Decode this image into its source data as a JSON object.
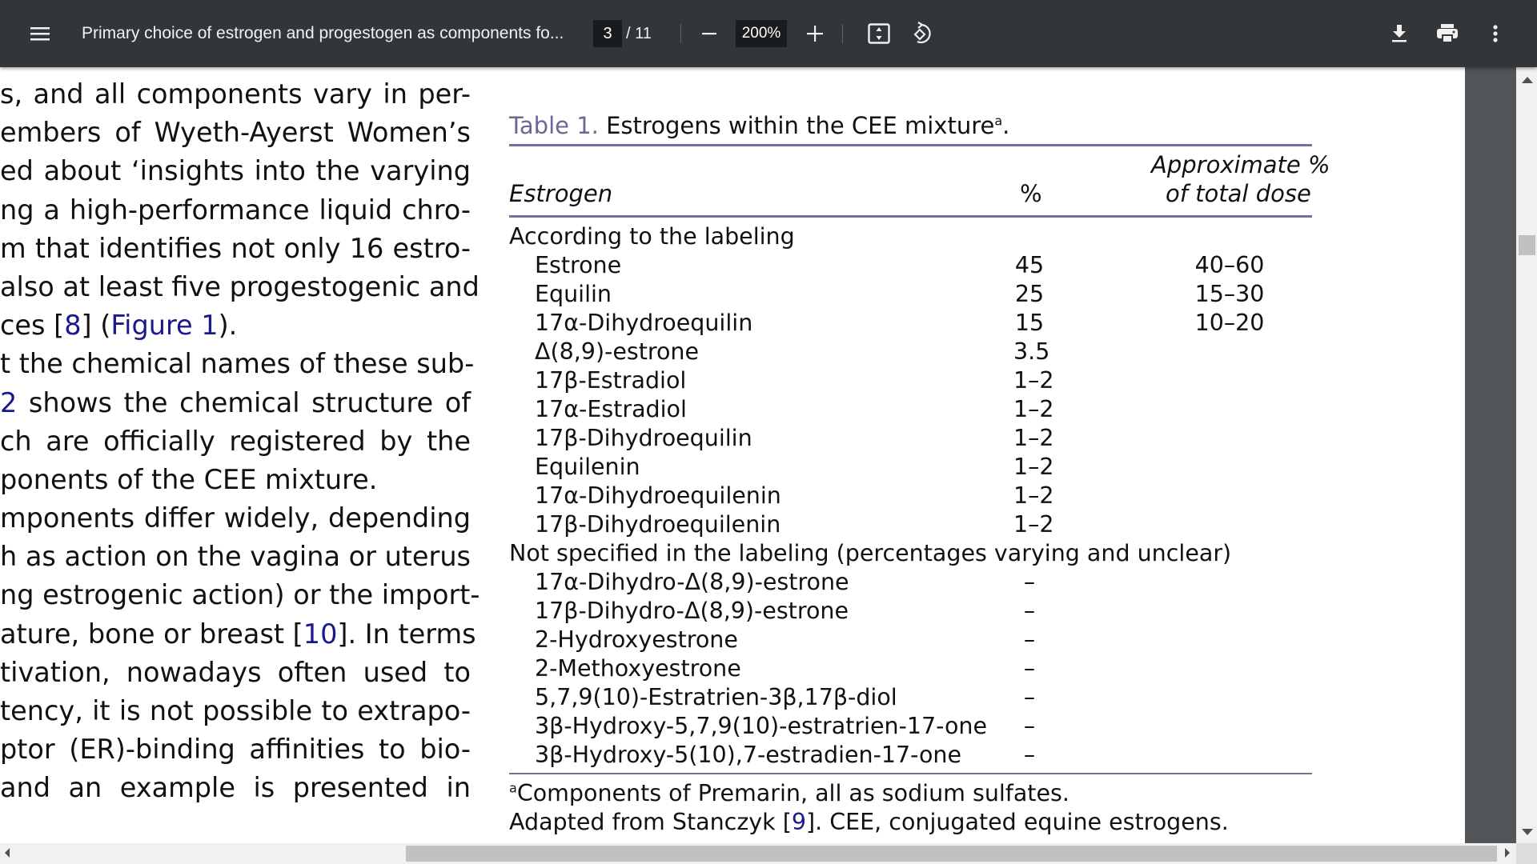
{
  "toolbar": {
    "title": "Primary choice of estrogen and progestogen as components fo...",
    "current_page": "3",
    "total_pages": "/ 11",
    "zoom_level": "200%",
    "icons": [
      "menu-icon",
      "zoom-out-icon",
      "zoom-in-icon",
      "fit-page-icon",
      "rotate-icon",
      "download-icon",
      "print-icon",
      "more-vert-icon"
    ]
  },
  "body_text": {
    "lines": [
      "s, and all components vary in per-",
      "embers of Wyeth-Ayerst Women’s",
      "ed about ‘insights into the varying",
      "ng a high-performance liquid chro-",
      "m that identifies not only 16 estro-",
      "also at least five progestogenic and",
      "ces [8] (Figure 1).",
      "t the chemical names of these sub-",
      "2 shows the chemical structure of",
      "ch are officially registered by the",
      "ponents of the CEE mixture.",
      "mponents differ widely, depending",
      "h as action on the vagina or uterus",
      "ng estrogenic action) or the import-",
      "ature, bone or breast [10]. In terms",
      "tivation, nowadays often used to",
      "tency, it is not possible to extrapo-",
      "ptor (ER)-binding affinities to bio-",
      " and an example is presented in"
    ],
    "links": [
      "8",
      "Figure 1",
      "2",
      "10"
    ]
  },
  "table": {
    "caption_label": "Table 1.",
    "caption_text": "Estrogens within the CEE mixture",
    "caption_sup": "a",
    "caption_end": ".",
    "headers": {
      "estrogen": "Estrogen",
      "percent": "%",
      "approx_line1": "Approximate %",
      "approx_line2": "of total dose"
    },
    "group1_label": "According to the labeling",
    "group1_rows": [
      {
        "name": "Estrone",
        "pct": "45",
        "approx": "40–60"
      },
      {
        "name": "Equilin",
        "pct": "25",
        "approx": "15–30"
      },
      {
        "name": "17α-Dihydroequilin",
        "pct": "15",
        "approx": "10–20"
      },
      {
        "name": "Δ(8,9)-estrone",
        "pct": "3.5",
        "approx": ""
      },
      {
        "name": "17β-Estradiol",
        "pct": "1–2",
        "approx": ""
      },
      {
        "name": "17α-Estradiol",
        "pct": "1–2",
        "approx": ""
      },
      {
        "name": "17β-Dihydroequilin",
        "pct": "1–2",
        "approx": ""
      },
      {
        "name": "Equilenin",
        "pct": "1–2",
        "approx": ""
      },
      {
        "name": "17α-Dihydroequilenin",
        "pct": "1–2",
        "approx": ""
      },
      {
        "name": "17β-Dihydroequilenin",
        "pct": "1–2",
        "approx": ""
      }
    ],
    "group2_label": "Not specified in the labeling (percentages varying and unclear)",
    "group2_rows": [
      {
        "name": "17α-Dihydro-Δ(8,9)-estrone",
        "pct": "–",
        "approx": ""
      },
      {
        "name": "17β-Dihydro-Δ(8,9)-estrone",
        "pct": "–",
        "approx": ""
      },
      {
        "name": "2-Hydroxyestrone",
        "pct": "–",
        "approx": ""
      },
      {
        "name": "2-Methoxyestrone",
        "pct": "–",
        "approx": ""
      },
      {
        "name": "5,7,9(10)-Estratrien-3β,17β-diol",
        "pct": "–",
        "approx": ""
      },
      {
        "name": "3β-Hydroxy-5,7,9(10)-estratrien-17-one",
        "pct": "–",
        "approx": ""
      },
      {
        "name": "3β-Hydroxy-5(10),7-estradien-17-one",
        "pct": "–",
        "approx": ""
      }
    ],
    "footnote_sup": "a",
    "footnote": "Components of Premarin, all as sodium sulfates.",
    "source_pre": "Adapted from Stanczyk [",
    "source_link": "9",
    "source_post": "]. CEE, conjugated equine estrogens."
  },
  "colors": {
    "toolbar_bg": "#323639",
    "caption_label": "#6b6796",
    "rule": "#756f9a",
    "link": "#1a1a8c"
  }
}
